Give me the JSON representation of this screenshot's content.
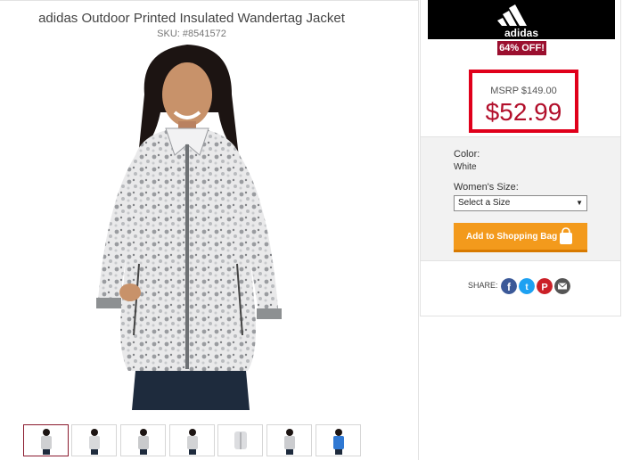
{
  "product": {
    "title": "adidas Outdoor Printed Insulated Wandertag Jacket",
    "sku": "SKU: #8541572",
    "brand": "adidas"
  },
  "pricing": {
    "discount_badge": "64% OFF!",
    "msrp": "MSRP $149.00",
    "price": "$52.99"
  },
  "options": {
    "color_label": "Color:",
    "color_value": "White",
    "size_label": "Women's Size:",
    "size_selected": "Select a Size"
  },
  "cart": {
    "add_label": "Add to Shopping Bag"
  },
  "share": {
    "label": "SHARE:",
    "icons": [
      "facebook-icon",
      "twitter-icon",
      "pinterest-icon",
      "email-icon"
    ]
  },
  "thumbnails": {
    "count": 7,
    "selected_index": 0
  },
  "colors": {
    "accent_red": "#e0001b",
    "price_red": "#b20f2b",
    "badge": "#9b0f2f",
    "button_orange": "#f39a1c",
    "facebook": "#3b5998",
    "twitter": "#1da1f2",
    "pinterest": "#cb2027",
    "email": "#555555"
  }
}
